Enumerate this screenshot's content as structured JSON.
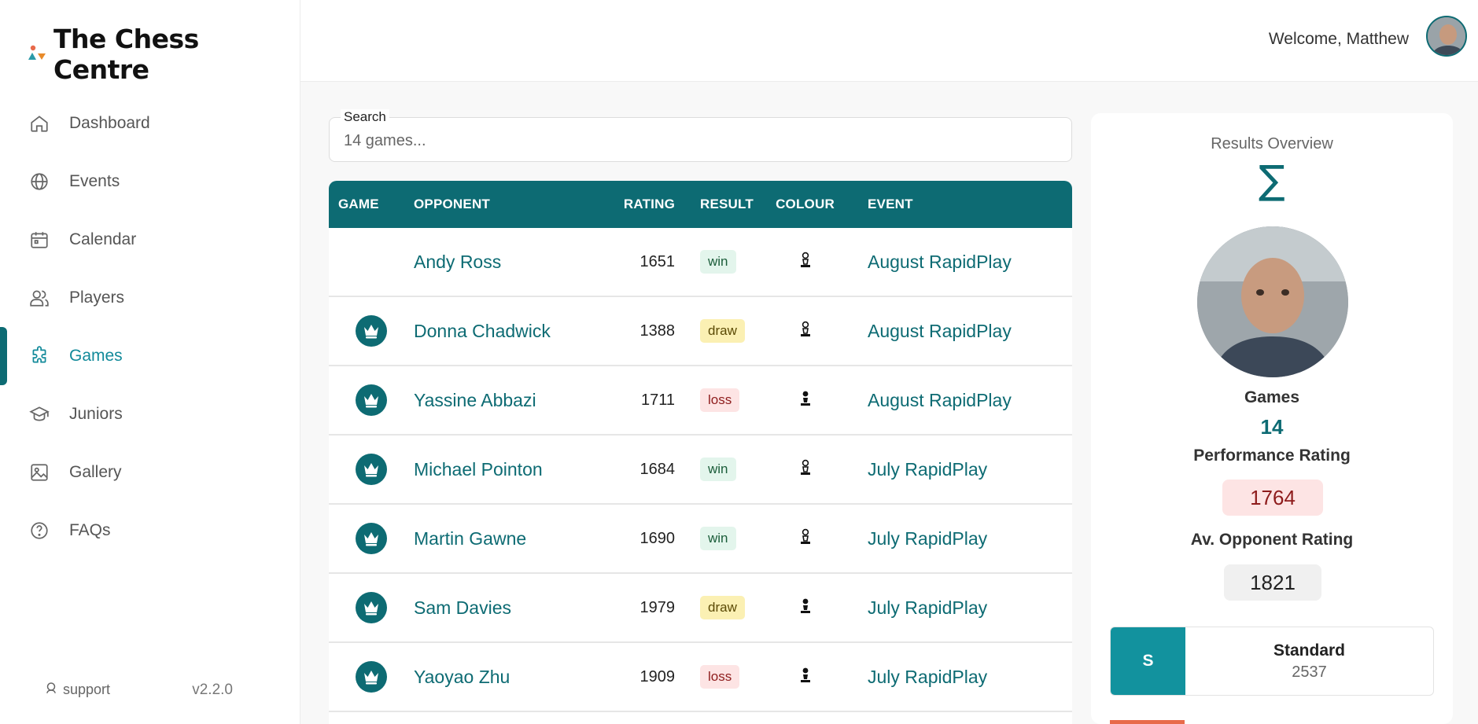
{
  "app": {
    "name": "The Chess Centre",
    "version": "v2.2.0",
    "support_label": "support"
  },
  "nav": [
    {
      "label": "Dashboard",
      "icon": "home-icon",
      "active": false
    },
    {
      "label": "Events",
      "icon": "globe-icon",
      "active": false
    },
    {
      "label": "Calendar",
      "icon": "calendar-icon",
      "active": false
    },
    {
      "label": "Players",
      "icon": "users-icon",
      "active": false
    },
    {
      "label": "Games",
      "icon": "puzzle-icon",
      "active": true
    },
    {
      "label": "Juniors",
      "icon": "graduation-cap-icon",
      "active": false
    },
    {
      "label": "Gallery",
      "icon": "image-icon",
      "active": false
    },
    {
      "label": "FAQs",
      "icon": "question-circle-icon",
      "active": false
    }
  ],
  "header": {
    "welcome": "Welcome, Matthew"
  },
  "search": {
    "label": "Search",
    "placeholder": "14 games..."
  },
  "table": {
    "columns": [
      "GAME",
      "OPPONENT",
      "RATING",
      "RESULT",
      "COLOUR",
      "EVENT"
    ],
    "rows": [
      {
        "has_icon": false,
        "opponent": "Andy Ross",
        "rating": "1651",
        "result": "win",
        "colour": "white",
        "event": "August RapidPlay"
      },
      {
        "has_icon": true,
        "opponent": "Donna Chadwick",
        "rating": "1388",
        "result": "draw",
        "colour": "white",
        "event": "August RapidPlay"
      },
      {
        "has_icon": true,
        "opponent": "Yassine Abbazi",
        "rating": "1711",
        "result": "loss",
        "colour": "black",
        "event": "August RapidPlay"
      },
      {
        "has_icon": true,
        "opponent": "Michael Pointon",
        "rating": "1684",
        "result": "win",
        "colour": "white",
        "event": "July RapidPlay"
      },
      {
        "has_icon": true,
        "opponent": "Martin Gawne",
        "rating": "1690",
        "result": "win",
        "colour": "white",
        "event": "July RapidPlay"
      },
      {
        "has_icon": true,
        "opponent": "Sam Davies",
        "rating": "1979",
        "result": "draw",
        "colour": "black",
        "event": "July RapidPlay"
      },
      {
        "has_icon": true,
        "opponent": "Yaoyao Zhu",
        "rating": "1909",
        "result": "loss",
        "colour": "black",
        "event": "July RapidPlay"
      }
    ]
  },
  "overview": {
    "title": "Results Overview",
    "sigma": "∑",
    "games_label": "Games",
    "games_value": "14",
    "performance_label": "Performance Rating",
    "performance_value": "1764",
    "avg_label": "Av. Opponent Rating",
    "avg_value": "1821",
    "standard": {
      "letter": "S",
      "name": "Standard",
      "value": "2537"
    }
  },
  "colors": {
    "primary": "#0d6b73",
    "accent": "#12929e",
    "win_bg": "#e3f5ec",
    "draw_bg": "#fbf0b3",
    "loss_bg": "#fde4e4"
  }
}
